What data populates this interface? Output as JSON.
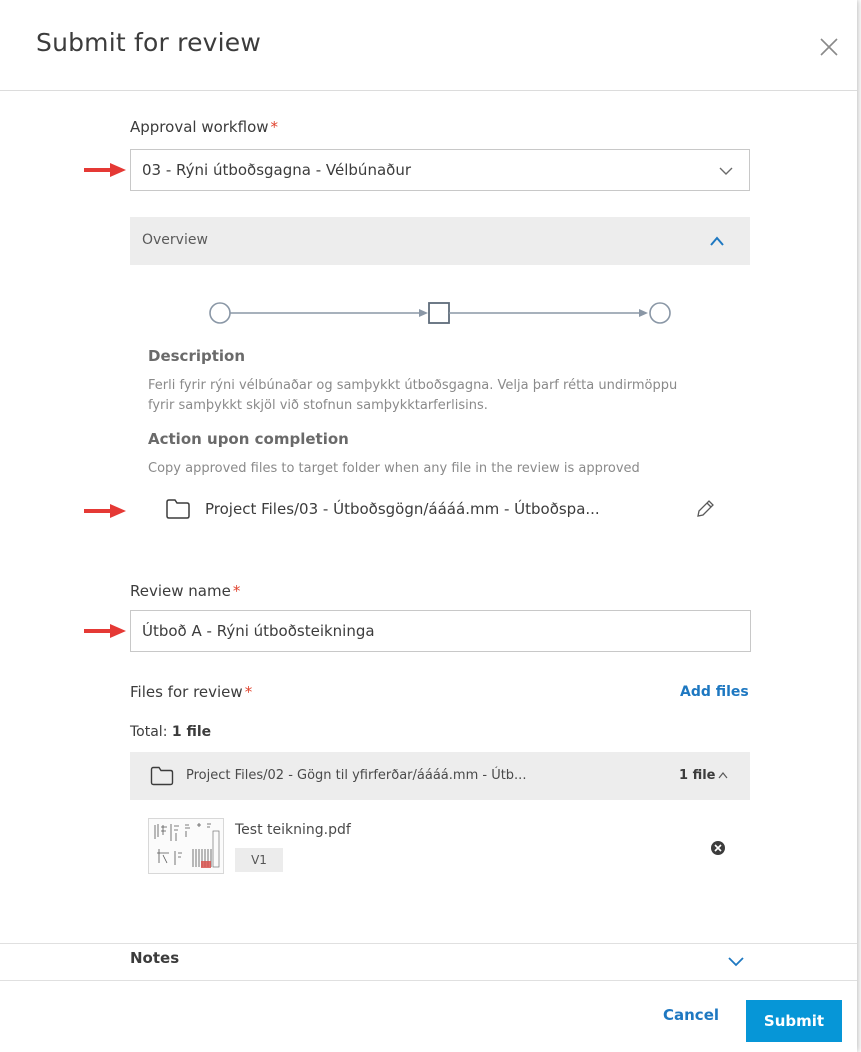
{
  "dialog": {
    "title": "Submit for review",
    "close_icon": "close-icon"
  },
  "workflow": {
    "label": "Approval workflow",
    "required_mark": "*",
    "selected": "03 - Rýni útboðsgagna - Vélbúnaður",
    "overview_label": "Overview",
    "description_heading": "Description",
    "description_line1": "Ferli fyrir rýni vélbúnaðar og samþykkt útboðsgagna. Velja þarf rétta undirmöppu",
    "description_line2": "fyrir samþykkt skjöl við stofnun samþykktarferlisins.",
    "action_heading": "Action upon completion",
    "action_text": "Copy approved files to target folder when any file in the review is approved",
    "target_folder": "Project Files/03 - Útboðsgögn/áááá.mm - Útboðspa..."
  },
  "review_name": {
    "label": "Review name",
    "required_mark": "*",
    "value": "Útboð A - Rýni útboðsteikninga"
  },
  "files": {
    "label": "Files for review",
    "required_mark": "*",
    "add_files_label": "Add files",
    "total_prefix": "Total:",
    "total_value": "1 file",
    "group_path": "Project Files/02 - Gögn til yfirferðar/áááá.mm - Útb...",
    "group_count": "1 file",
    "items": [
      {
        "name": "Test teikning.pdf",
        "version": "V1"
      }
    ]
  },
  "notes": {
    "label": "Notes"
  },
  "footer": {
    "cancel_label": "Cancel",
    "submit_label": "Submit"
  },
  "colors": {
    "accent": "#0696d7",
    "link": "#1e78c1",
    "required": "#e0432e",
    "annotation_arrow": "#e53935"
  }
}
